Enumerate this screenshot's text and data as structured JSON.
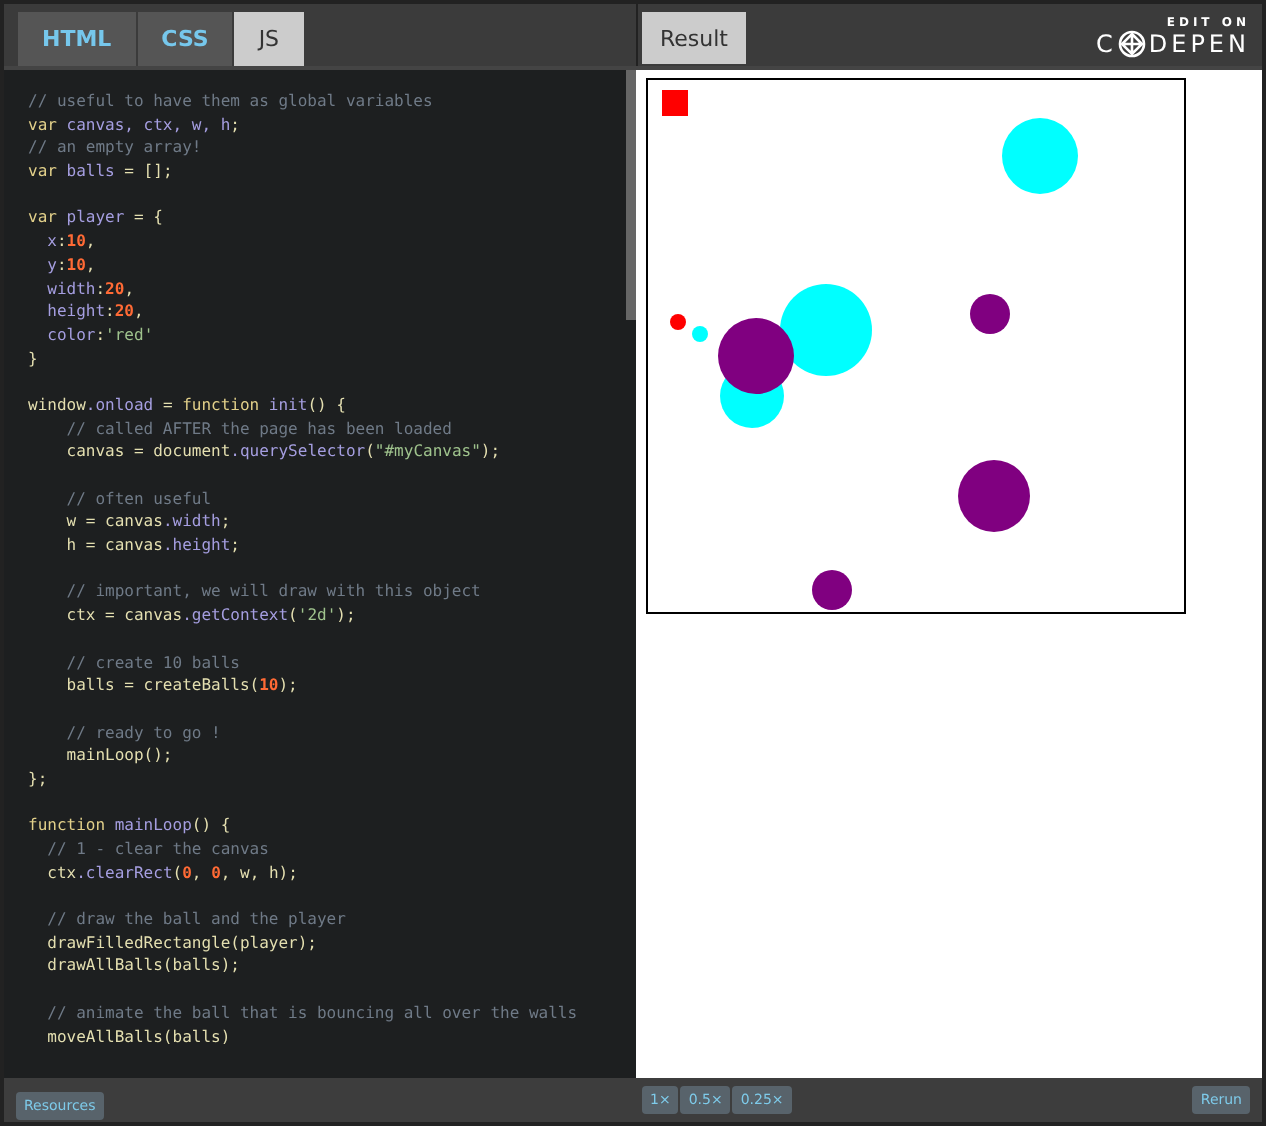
{
  "editor_tabs": [
    {
      "label": "HTML",
      "selected": false
    },
    {
      "label": "CSS",
      "selected": false
    },
    {
      "label": "JS",
      "selected": true
    }
  ],
  "result_tab": {
    "label": "Result",
    "selected": true
  },
  "brand": {
    "caption": "EDIT ON",
    "left": "C",
    "right": "DEPEN"
  },
  "code_lines": [
    {
      "blank_before": false,
      "tokens": [
        {
          "kind": "comment",
          "text": "// useful to have them as global variables"
        }
      ]
    },
    {
      "blank_before": false,
      "tokens": [
        {
          "kind": "keyword",
          "text": "var"
        },
        {
          "kind": "variable",
          "text": " canvas, ctx, w, h"
        },
        {
          "kind": "plain",
          "text": ";"
        }
      ]
    },
    {
      "blank_before": false,
      "tokens": [
        {
          "kind": "comment",
          "text": "// an empty array!"
        }
      ]
    },
    {
      "blank_before": false,
      "tokens": [
        {
          "kind": "keyword",
          "text": "var"
        },
        {
          "kind": "variable",
          "text": " balls"
        },
        {
          "kind": "plain",
          "text": " = [];"
        }
      ]
    },
    {
      "blank_before": true,
      "tokens": [
        {
          "kind": "keyword",
          "text": "var"
        },
        {
          "kind": "variable",
          "text": " player"
        },
        {
          "kind": "plain",
          "text": " = {"
        }
      ]
    },
    {
      "blank_before": false,
      "tokens": [
        {
          "kind": "variable",
          "text": "  x"
        },
        {
          "kind": "plain",
          "text": ":"
        },
        {
          "kind": "number",
          "text": "10"
        },
        {
          "kind": "plain",
          "text": ","
        }
      ]
    },
    {
      "blank_before": false,
      "tokens": [
        {
          "kind": "variable",
          "text": "  y"
        },
        {
          "kind": "plain",
          "text": ":"
        },
        {
          "kind": "number",
          "text": "10"
        },
        {
          "kind": "plain",
          "text": ","
        }
      ]
    },
    {
      "blank_before": false,
      "tokens": [
        {
          "kind": "variable",
          "text": "  width"
        },
        {
          "kind": "plain",
          "text": ":"
        },
        {
          "kind": "number",
          "text": "20"
        },
        {
          "kind": "plain",
          "text": ","
        }
      ]
    },
    {
      "blank_before": false,
      "tokens": [
        {
          "kind": "variable",
          "text": "  height"
        },
        {
          "kind": "plain",
          "text": ":"
        },
        {
          "kind": "number",
          "text": "20"
        },
        {
          "kind": "plain",
          "text": ","
        }
      ]
    },
    {
      "blank_before": false,
      "tokens": [
        {
          "kind": "variable",
          "text": "  color"
        },
        {
          "kind": "plain",
          "text": ":"
        },
        {
          "kind": "string",
          "text": "'red'"
        }
      ]
    },
    {
      "blank_before": false,
      "tokens": [
        {
          "kind": "plain",
          "text": "}"
        }
      ]
    },
    {
      "blank_before": true,
      "tokens": [
        {
          "kind": "plain",
          "text": "window"
        },
        {
          "kind": "variable",
          "text": ".onload"
        },
        {
          "kind": "plain",
          "text": " = "
        },
        {
          "kind": "keyword",
          "text": "function"
        },
        {
          "kind": "variable",
          "text": " init"
        },
        {
          "kind": "plain",
          "text": "() {"
        }
      ]
    },
    {
      "blank_before": false,
      "tokens": [
        {
          "kind": "comment",
          "text": "    // called AFTER the page has been loaded"
        }
      ]
    },
    {
      "blank_before": false,
      "tokens": [
        {
          "kind": "plain",
          "text": "    canvas = document"
        },
        {
          "kind": "variable",
          "text": ".querySelector"
        },
        {
          "kind": "plain",
          "text": "("
        },
        {
          "kind": "string",
          "text": "\"#myCanvas\""
        },
        {
          "kind": "plain",
          "text": ");"
        }
      ]
    },
    {
      "blank_before": true,
      "tokens": [
        {
          "kind": "comment",
          "text": "    // often useful"
        }
      ]
    },
    {
      "blank_before": false,
      "tokens": [
        {
          "kind": "plain",
          "text": "    w = canvas"
        },
        {
          "kind": "variable",
          "text": ".width"
        },
        {
          "kind": "plain",
          "text": ";"
        }
      ]
    },
    {
      "blank_before": false,
      "tokens": [
        {
          "kind": "plain",
          "text": "    h = canvas"
        },
        {
          "kind": "variable",
          "text": ".height"
        },
        {
          "kind": "plain",
          "text": ";"
        }
      ]
    },
    {
      "blank_before": true,
      "tokens": [
        {
          "kind": "comment",
          "text": "    // important, we will draw with this object"
        }
      ]
    },
    {
      "blank_before": false,
      "tokens": [
        {
          "kind": "plain",
          "text": "    ctx = canvas"
        },
        {
          "kind": "variable",
          "text": ".getContext"
        },
        {
          "kind": "plain",
          "text": "("
        },
        {
          "kind": "string",
          "text": "'2d'"
        },
        {
          "kind": "plain",
          "text": ");"
        }
      ]
    },
    {
      "blank_before": true,
      "tokens": [
        {
          "kind": "comment",
          "text": "    // create 10 balls"
        }
      ]
    },
    {
      "blank_before": false,
      "tokens": [
        {
          "kind": "plain",
          "text": "    balls = createBalls("
        },
        {
          "kind": "number",
          "text": "10"
        },
        {
          "kind": "plain",
          "text": ");"
        }
      ]
    },
    {
      "blank_before": true,
      "tokens": [
        {
          "kind": "comment",
          "text": "    // ready to go !"
        }
      ]
    },
    {
      "blank_before": false,
      "tokens": [
        {
          "kind": "plain",
          "text": "    mainLoop();"
        }
      ]
    },
    {
      "blank_before": false,
      "tokens": [
        {
          "kind": "plain",
          "text": "};"
        }
      ]
    },
    {
      "blank_before": true,
      "tokens": [
        {
          "kind": "keyword",
          "text": "function"
        },
        {
          "kind": "variable",
          "text": " mainLoop"
        },
        {
          "kind": "plain",
          "text": "() {"
        }
      ]
    },
    {
      "blank_before": false,
      "tokens": [
        {
          "kind": "comment",
          "text": "  // 1 - clear the canvas"
        }
      ]
    },
    {
      "blank_before": false,
      "tokens": [
        {
          "kind": "plain",
          "text": "  ctx"
        },
        {
          "kind": "variable",
          "text": ".clearRect"
        },
        {
          "kind": "plain",
          "text": "("
        },
        {
          "kind": "number",
          "text": "0"
        },
        {
          "kind": "plain",
          "text": ", "
        },
        {
          "kind": "number",
          "text": "0"
        },
        {
          "kind": "plain",
          "text": ", w, h);"
        }
      ]
    },
    {
      "blank_before": true,
      "tokens": [
        {
          "kind": "comment",
          "text": "  // draw the ball and the player"
        }
      ]
    },
    {
      "blank_before": false,
      "tokens": [
        {
          "kind": "plain",
          "text": "  drawFilledRectangle(player);"
        }
      ]
    },
    {
      "blank_before": false,
      "tokens": [
        {
          "kind": "plain",
          "text": "  drawAllBalls(balls);"
        }
      ]
    },
    {
      "blank_before": true,
      "tokens": [
        {
          "kind": "comment",
          "text": "  // animate the ball that is bouncing all over the walls"
        }
      ]
    },
    {
      "blank_before": false,
      "tokens": [
        {
          "kind": "plain",
          "text": "  moveAllBalls(balls)"
        }
      ]
    }
  ],
  "footer": {
    "resources": "Resources",
    "zoom_buttons": [
      "1×",
      "0.5×",
      "0.25×"
    ],
    "rerun": "Rerun"
  }
}
